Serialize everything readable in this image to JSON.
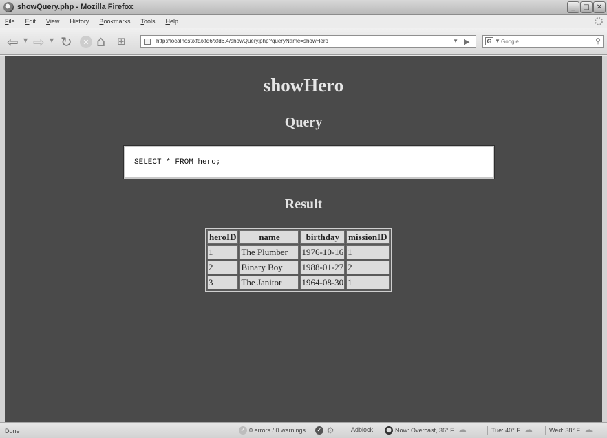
{
  "window": {
    "title": "showQuery.php - Mozilla Firefox",
    "buttons": {
      "minimize": "_",
      "maximize": "□",
      "close": "✕"
    }
  },
  "menu": [
    {
      "label": "File",
      "key": "F",
      "rest": "ile"
    },
    {
      "label": "Edit",
      "key": "E",
      "rest": "dit"
    },
    {
      "label": "View",
      "key": "V",
      "rest": "iew"
    },
    {
      "label": "History",
      "key": "",
      "rest": "History"
    },
    {
      "label": "Bookmarks",
      "key": "B",
      "rest": "ookmarks"
    },
    {
      "label": "Tools",
      "key": "T",
      "rest": "ools"
    },
    {
      "label": "Help",
      "key": "H",
      "rest": "elp"
    }
  ],
  "toolbar": {
    "url": "http://localhost/xfd/xfd6/xfd6.4/showQuery.php?queryName=showHero",
    "search_placeholder": "Google",
    "search_engine": "G"
  },
  "page": {
    "heading": "showHero",
    "query_heading": "Query",
    "query_text": "SELECT * FROM hero;",
    "result_heading": "Result",
    "table": {
      "columns": [
        "heroID",
        "name",
        "birthday",
        "missionID"
      ],
      "rows": [
        [
          "1",
          "The Plumber",
          "1976-10-16",
          "1"
        ],
        [
          "2",
          "Binary Boy",
          "1988-01-27",
          "2"
        ],
        [
          "3",
          "The Janitor",
          "1964-08-30",
          "1"
        ]
      ]
    }
  },
  "status": {
    "done": "Done",
    "errors": "0 errors / 0 warnings",
    "adblock": "Adblock",
    "now": "Now: Overcast, 36° F",
    "tue": "Tue: 40° F",
    "wed": "Wed: 38° F"
  }
}
